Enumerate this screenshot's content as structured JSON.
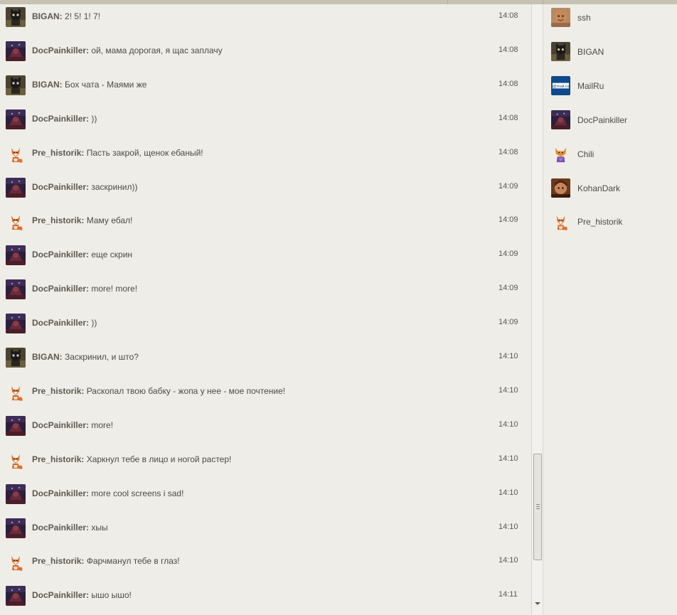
{
  "messages": [
    {
      "author": "BIGAN:",
      "text": "2! 5! 1! 7!",
      "time": "14:08",
      "avatar": "bigan"
    },
    {
      "author": "DocPainkiller:",
      "text": "ой, мама дорогая, я щас заплачу",
      "time": "14:08",
      "avatar": "doc"
    },
    {
      "author": "BIGAN:",
      "text": "Бох чата - Маями же",
      "time": "14:08",
      "avatar": "bigan"
    },
    {
      "author": "DocPainkiller:",
      "text": "))",
      "time": "14:08",
      "avatar": "doc"
    },
    {
      "author": "Pre_historik:",
      "text": "Пасть закрой, щенок ебаный!",
      "time": "14:08",
      "avatar": "fox"
    },
    {
      "author": "DocPainkiller:",
      "text": "заскринил))",
      "time": "14:09",
      "avatar": "doc"
    },
    {
      "author": "Pre_historik:",
      "text": "Маму ебал!",
      "time": "14:09",
      "avatar": "fox"
    },
    {
      "author": "DocPainkiller:",
      "text": "еще скрин",
      "time": "14:09",
      "avatar": "doc"
    },
    {
      "author": "DocPainkiller:",
      "text": "more! more!",
      "time": "14:09",
      "avatar": "doc"
    },
    {
      "author": "DocPainkiller:",
      "text": "))",
      "time": "14:09",
      "avatar": "doc"
    },
    {
      "author": "BIGAN:",
      "text": "Заскринил, и што?",
      "time": "14:10",
      "avatar": "bigan"
    },
    {
      "author": "Pre_historik:",
      "text": "Раскопал твою бабку - жопа у нее - мое почтение!",
      "time": "14:10",
      "avatar": "fox"
    },
    {
      "author": "DocPainkiller:",
      "text": "more!",
      "time": "14:10",
      "avatar": "doc"
    },
    {
      "author": "Pre_historik:",
      "text": "Харкнул тебе в лицо и ногой растер!",
      "time": "14:10",
      "avatar": "fox"
    },
    {
      "author": "DocPainkiller:",
      "text": "more cool screens i sad!",
      "time": "14:10",
      "avatar": "doc"
    },
    {
      "author": "DocPainkiller:",
      "text": "хыы",
      "time": "14:10",
      "avatar": "doc"
    },
    {
      "author": "Pre_historik:",
      "text": "Фарчманул тебе в глаз!",
      "time": "14:10",
      "avatar": "fox"
    },
    {
      "author": "DocPainkiller:",
      "text": "ышо ышо!",
      "time": "14:11",
      "avatar": "doc"
    }
  ],
  "users": [
    {
      "name": "ssh",
      "avatar": "ssh"
    },
    {
      "name": "BIGAN",
      "avatar": "bigan"
    },
    {
      "name": "MailRu",
      "avatar": "mailru"
    },
    {
      "name": "DocPainkiller",
      "avatar": "doc"
    },
    {
      "name": "Chili",
      "avatar": "chili"
    },
    {
      "name": "KohanDark",
      "avatar": "kohan"
    },
    {
      "name": "Pre_historik",
      "avatar": "fox"
    }
  ],
  "colors": {
    "background": "#efede8",
    "text": "#4d4a43",
    "author": "#5c584f"
  }
}
